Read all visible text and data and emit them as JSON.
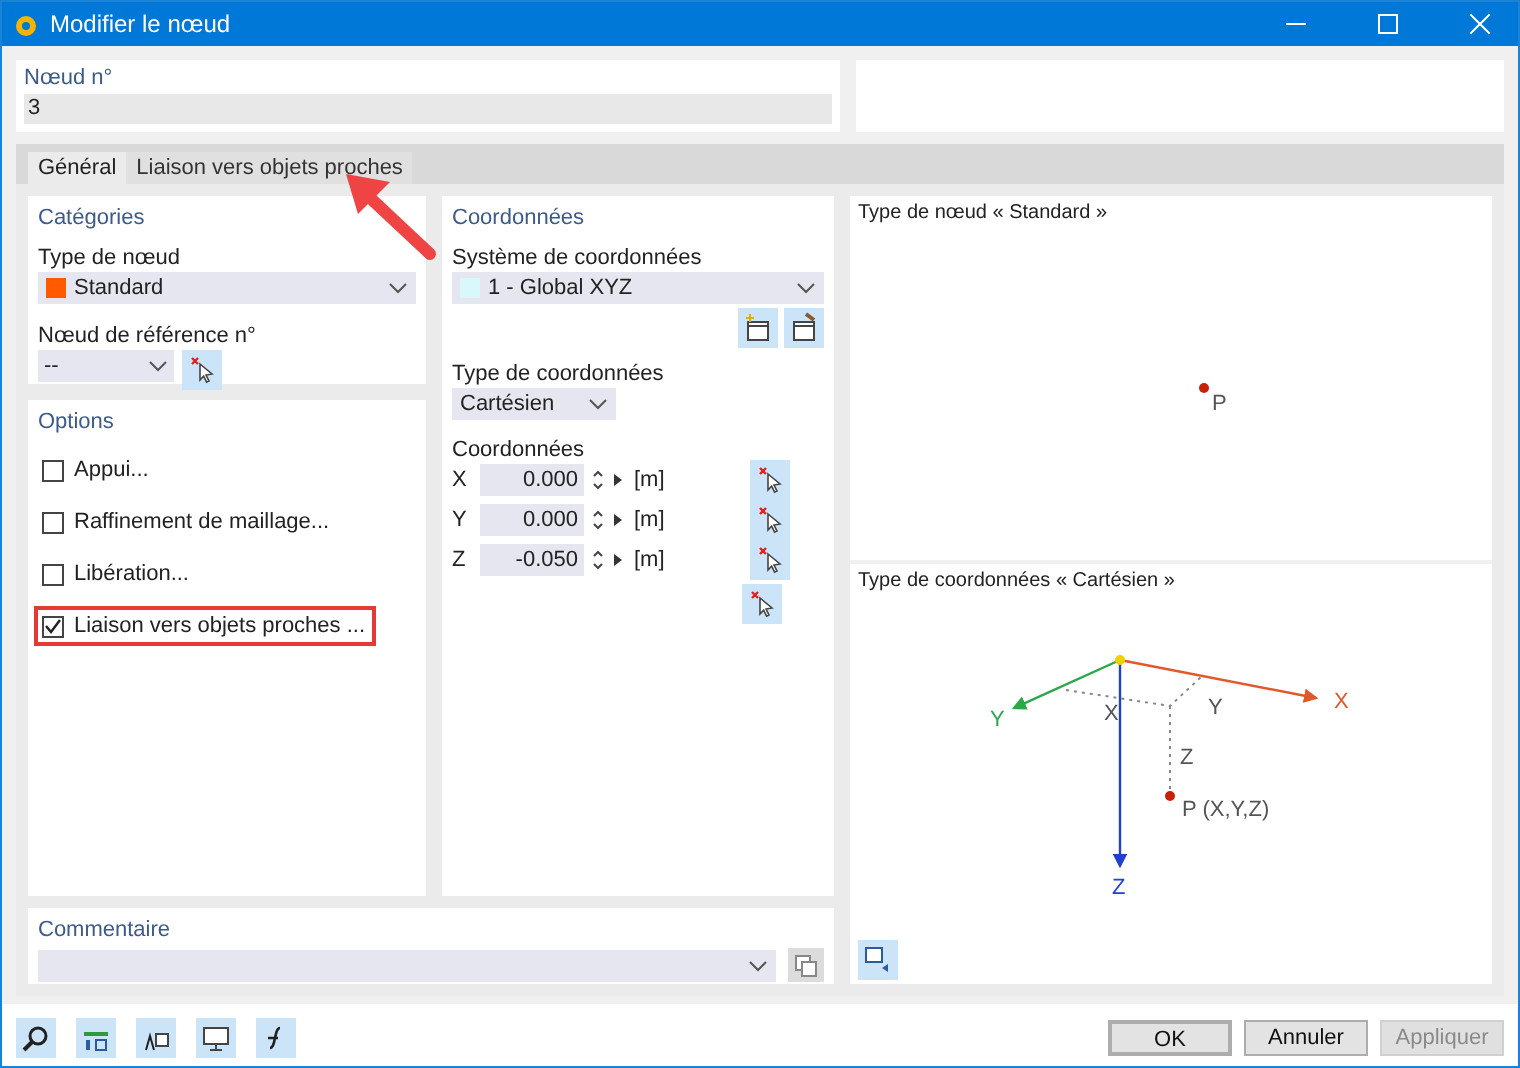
{
  "window": {
    "title": "Modifier le nœud"
  },
  "node_number": {
    "label": "Nœud n°",
    "value": "3"
  },
  "tabs": [
    {
      "label": "Général",
      "selected": true
    },
    {
      "label": "Liaison vers objets proches",
      "selected": false
    }
  ],
  "categories": {
    "title": "Catégories",
    "node_type_label": "Type de nœud",
    "node_type_value": "Standard",
    "reference_node_label": "Nœud de référence n°",
    "reference_node_value": "--"
  },
  "options": {
    "title": "Options",
    "items": [
      {
        "label": "Appui...",
        "checked": false,
        "highlighted": false
      },
      {
        "label": "Raffinement de maillage...",
        "checked": false,
        "highlighted": false
      },
      {
        "label": "Libération...",
        "checked": false,
        "highlighted": false
      },
      {
        "label": "Liaison vers objets proches ...",
        "checked": true,
        "highlighted": true
      }
    ]
  },
  "coordinates": {
    "title": "Coordonnées",
    "system_label": "Système de coordonnées",
    "system_value": "1 - Global XYZ",
    "type_label": "Type de coordonnées",
    "type_value": "Cartésien",
    "values_label": "Coordonnées",
    "rows": [
      {
        "axis": "X",
        "value": "0.000",
        "unit": "[m]"
      },
      {
        "axis": "Y",
        "value": "0.000",
        "unit": "[m]"
      },
      {
        "axis": "Z",
        "value": "-0.050",
        "unit": "[m]"
      }
    ]
  },
  "node_preview": {
    "title": "Type de nœud « Standard »",
    "point_label": "P"
  },
  "coord_preview": {
    "title": "Type de coordonnées « Cartésien »",
    "x_axis": "X",
    "y_axis": "Y",
    "z_axis": "Z",
    "x_projection": "X",
    "y_projection": "Y",
    "z_projection": "Z",
    "point_label": "P (X,Y,Z)"
  },
  "comment": {
    "title": "Commentaire"
  },
  "buttons": [
    {
      "label": "OK",
      "disabled": false,
      "default": true
    },
    {
      "label": "Annuler",
      "disabled": false,
      "default": false
    },
    {
      "label": "Appliquer",
      "disabled": true,
      "default": false
    }
  ]
}
